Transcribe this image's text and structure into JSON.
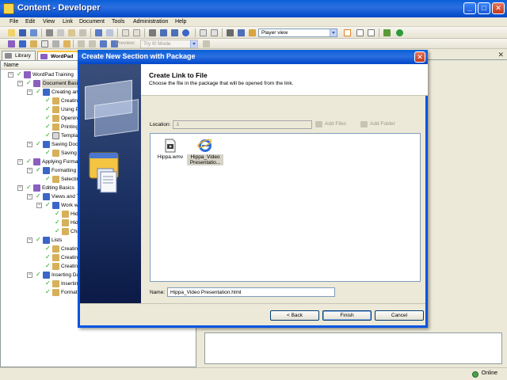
{
  "window": {
    "title": "Content - Developer",
    "controls": [
      "minimize",
      "maximize",
      "close"
    ]
  },
  "menu": [
    "File",
    "Edit",
    "View",
    "Link",
    "Document",
    "Tools",
    "Administration",
    "Help"
  ],
  "toolbar": {
    "view_combo": "Player view",
    "preview_label": "Preview:",
    "mode_combo": "Try It! Mode"
  },
  "left_tabs": [
    {
      "label": "Library",
      "active": false
    },
    {
      "label": "WordPad",
      "active": true
    }
  ],
  "tree": {
    "column_header": "Name",
    "items": [
      {
        "label": "WordPad Training",
        "indent": 0,
        "expanded": true,
        "icon": "outline-icon",
        "checked": true
      },
      {
        "label": "Document Basics",
        "indent": 1,
        "expanded": true,
        "icon": "outline-icon",
        "checked": true,
        "selected": "secondary"
      },
      {
        "label": "Creating and",
        "indent": 2,
        "expanded": true,
        "icon": "module-icon",
        "checked": true
      },
      {
        "label": "Creating a",
        "indent": 3,
        "icon": "topic-icon",
        "checked": true
      },
      {
        "label": "Using Print",
        "indent": 3,
        "icon": "topic-icon",
        "checked": true
      },
      {
        "label": "Opening a",
        "indent": 3,
        "icon": "topic-icon",
        "checked": true
      },
      {
        "label": "Printing a",
        "indent": 3,
        "icon": "topic-icon",
        "checked": true
      },
      {
        "label": "Templates",
        "indent": 3,
        "icon": "document-icon",
        "checked": true
      },
      {
        "label": "Saving Docum",
        "indent": 2,
        "expanded": true,
        "icon": "module-icon",
        "checked": true
      },
      {
        "label": "Saving a D",
        "indent": 3,
        "icon": "topic-icon",
        "checked": true
      },
      {
        "label": "Applying Formatti",
        "indent": 1,
        "expanded": true,
        "icon": "outline-icon",
        "checked": true
      },
      {
        "label": "Formatting Pa",
        "indent": 2,
        "expanded": true,
        "icon": "module-icon",
        "checked": true
      },
      {
        "label": "Selecting P",
        "indent": 3,
        "icon": "topic-icon",
        "checked": true
      },
      {
        "label": "Editing Basics",
        "indent": 1,
        "expanded": true,
        "icon": "outline-icon",
        "checked": true
      },
      {
        "label": "Views and Too",
        "indent": 2,
        "expanded": true,
        "icon": "module-icon",
        "checked": true
      },
      {
        "label": "Work with",
        "indent": 3,
        "expanded": true,
        "icon": "module-icon",
        "checked": true
      },
      {
        "label": "Hiding",
        "indent": 4,
        "icon": "topic-icon",
        "checked": true
      },
      {
        "label": "Hiding",
        "indent": 4,
        "icon": "topic-icon",
        "checked": true
      },
      {
        "label": "Chang",
        "indent": 4,
        "icon": "topic-icon",
        "checked": true
      },
      {
        "label": "Lists",
        "indent": 2,
        "expanded": true,
        "icon": "module-icon",
        "checked": true
      },
      {
        "label": "Creating C",
        "indent": 3,
        "icon": "topic-icon",
        "checked": true
      },
      {
        "label": "Creating B",
        "indent": 3,
        "icon": "topic-icon",
        "checked": true
      },
      {
        "label": "Creating N",
        "indent": 3,
        "icon": "topic-icon",
        "checked": true
      },
      {
        "label": "Inserting Date",
        "indent": 2,
        "expanded": true,
        "icon": "module-icon",
        "checked": true
      },
      {
        "label": "Inserting t",
        "indent": 3,
        "icon": "topic-icon",
        "checked": true
      },
      {
        "label": "Formatting",
        "indent": 3,
        "icon": "topic-icon",
        "checked": true
      }
    ]
  },
  "dialog": {
    "title": "Create New Section with Package",
    "heading": "Create Link to File",
    "subheading": "Choose the file in the package that will be opened from the link.",
    "location_label": "Location:",
    "location_value": ".\\",
    "add_files_label": "Add Files",
    "add_folder_label": "Add Folder",
    "files": [
      {
        "name": "Hippa.wmv",
        "icon": "video-file-icon",
        "selected": false
      },
      {
        "name": "Hippa_Video Presentatio...",
        "icon": "internet-explorer-icon",
        "selected": true
      }
    ],
    "name_label": "Name:",
    "name_value": "Hippa_Video Presentation.html",
    "buttons": {
      "back": "< Back",
      "finish": "Finish",
      "cancel": "Cancel"
    }
  },
  "status": {
    "online_label": "Online"
  },
  "colors": {
    "xp_blue": "#0054e3",
    "check_green": "#1aa314",
    "selection": "#316ac5"
  }
}
